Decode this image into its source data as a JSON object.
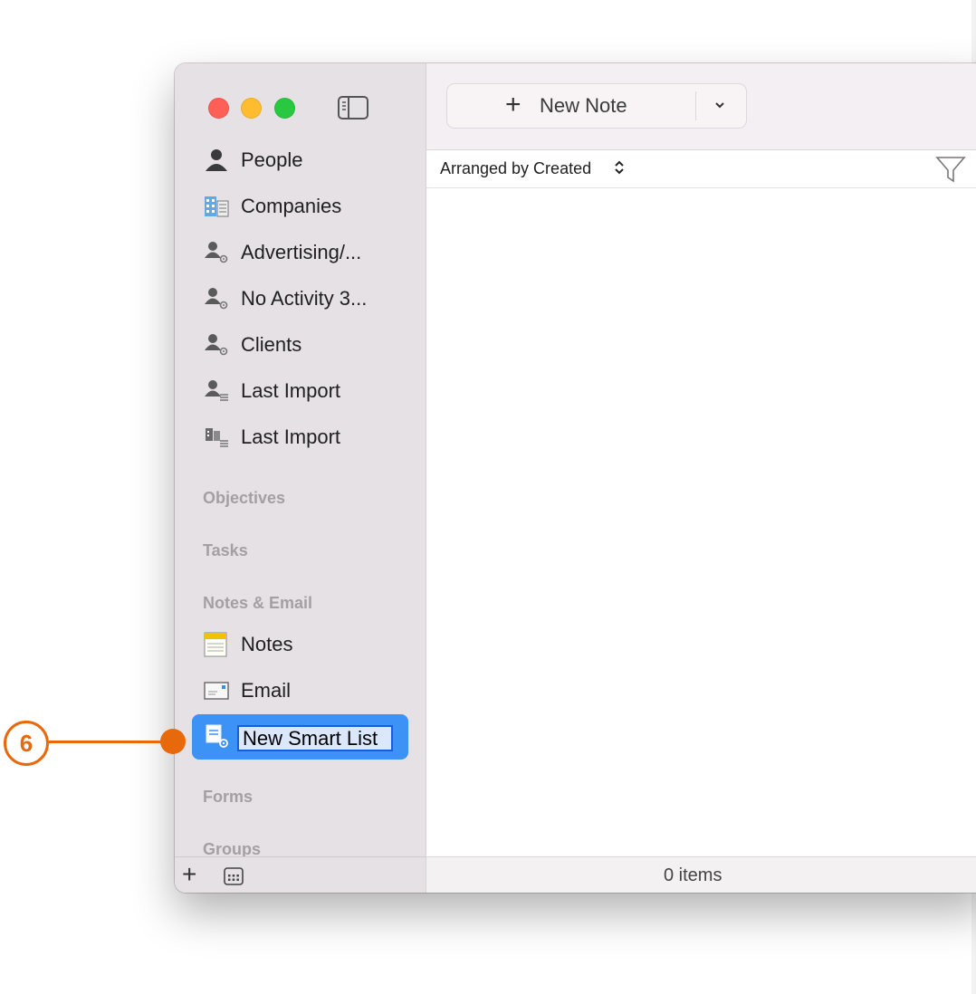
{
  "toolbar": {
    "new_note_label": "New Note"
  },
  "sidebar": {
    "items": [
      {
        "label": "People",
        "icon": "person-icon"
      },
      {
        "label": "Companies",
        "icon": "company-icon"
      },
      {
        "label": "Advertising/...",
        "icon": "smart-people-icon"
      },
      {
        "label": "No Activity 3...",
        "icon": "smart-people-icon"
      },
      {
        "label": "Clients",
        "icon": "smart-people-icon"
      },
      {
        "label": "Last Import",
        "icon": "people-list-icon"
      },
      {
        "label": "Last Import",
        "icon": "company-list-icon"
      }
    ],
    "sections": {
      "objectives": "Objectives",
      "tasks": "Tasks",
      "notes_email": "Notes & Email",
      "forms": "Forms",
      "groups": "Groups"
    },
    "notes_items": [
      {
        "label": "Notes",
        "icon": "notes-icon"
      },
      {
        "label": "Email",
        "icon": "email-icon"
      }
    ],
    "editing_item": {
      "value": "New Smart List",
      "icon": "smart-list-icon"
    }
  },
  "list": {
    "arrange_label": "Arranged by Created"
  },
  "status": {
    "count_text": "0 items"
  },
  "annotation": {
    "step_number": "6"
  },
  "colors": {
    "accent": "#3d92f5",
    "callout": "#e8680c"
  }
}
